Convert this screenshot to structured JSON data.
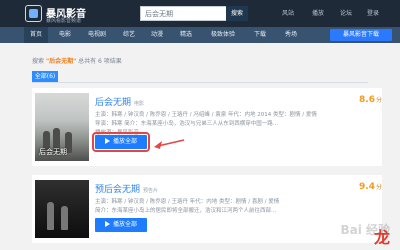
{
  "header": {
    "logo_name": "暴风影音",
    "logo_sub": "暴风看影音频道",
    "search_value": "后会无期",
    "search_button": "搜索",
    "right_items": [
      "风站",
      "播放",
      "论坛",
      "登录"
    ]
  },
  "nav": {
    "items": [
      "首页",
      "电影",
      "电视剧",
      "综艺",
      "动漫",
      "精选",
      "极致体验",
      "下载",
      "秀场"
    ],
    "download_label": "暴风影音下载"
  },
  "results": {
    "prefix": "搜索",
    "keyword": "\"后会无期\"",
    "suffix": "总共有 6 项结果",
    "tab_all": "全部(6)"
  },
  "movies": [
    {
      "title": "后会无期",
      "tag": "电影",
      "score": "8.6",
      "score_unit": "分",
      "line1": "主演：韩寒 / 钟汉良 / 陈乔恩 / 王珞丹 / 冯绍峰 / 袁泉 年代：内地 2014 类型：剧情 / 爱情",
      "line2": "导演：韩寒 简介：东海某座小岛，浩汉与兄弟三人从东到西横穿中国一路...",
      "line3": "播放源：暴风影音",
      "button": "播放全部",
      "poster_text": "后会无期"
    },
    {
      "title": "预后会无期",
      "tag": "预告片",
      "score": "9.4",
      "score_unit": "分",
      "line1": "主演：韩寒 / 钟汉良 / 陈乔恩 / 王珞丹 年代：内地 类型：剧情 / 喜剧 / 爱情",
      "line2": "简介：东海某座小岛上的居民即将全部搬迁，浩汉和江河两个人前往西部...",
      "line3": "",
      "button": "播放全部",
      "poster_text": ""
    }
  ],
  "watermark": "Bai 经验",
  "watermark_mark": "龙"
}
